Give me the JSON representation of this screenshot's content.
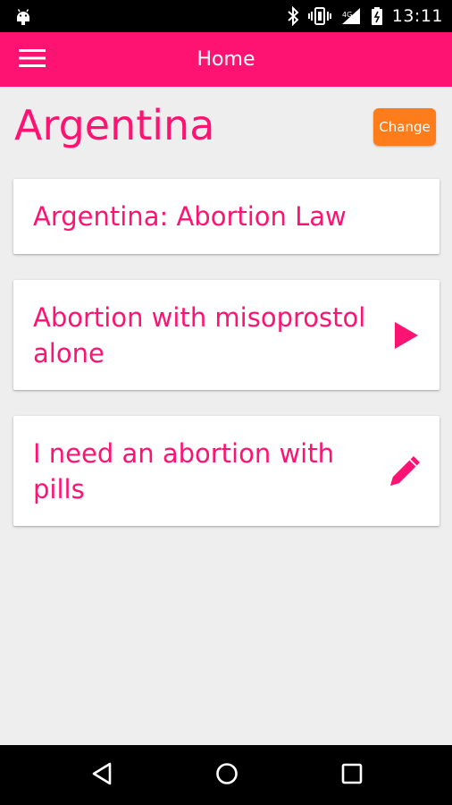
{
  "status_bar": {
    "time": "13:11",
    "icons": [
      "android-icon",
      "bluetooth-icon",
      "vibrate-icon",
      "signal-icon",
      "battery-icon"
    ]
  },
  "app_bar": {
    "title": "Home",
    "menu_icon": "hamburger-menu-icon"
  },
  "country": {
    "name": "Argentina",
    "change_label": "Change"
  },
  "cards": [
    {
      "label": "Argentina: Abortion Law",
      "icon": null
    },
    {
      "label": "Abortion with misoprostol alone",
      "icon": "play-icon"
    },
    {
      "label": "I need an abortion with pills",
      "icon": "pencil-icon"
    }
  ],
  "nav_bar": {
    "icons": [
      "back-icon",
      "home-icon",
      "recents-icon"
    ]
  },
  "colors": {
    "accent": "#FF1372",
    "change_button": "#FF7C1B",
    "background": "#EEEEEE",
    "card": "#FFFFFF"
  }
}
